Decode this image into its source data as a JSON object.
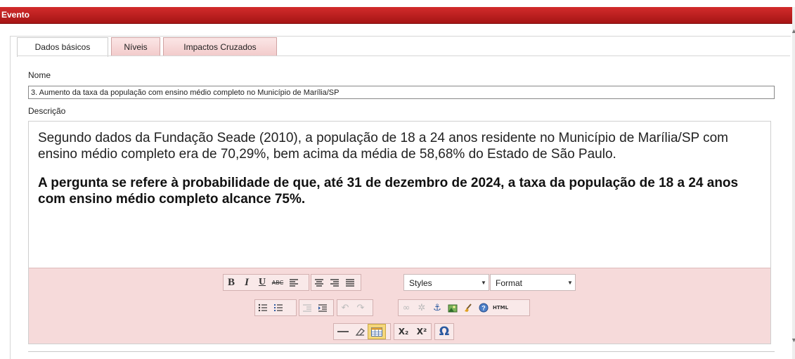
{
  "window": {
    "title": "Evento"
  },
  "tabs": [
    {
      "label": "Dados básicos",
      "active": true
    },
    {
      "label": "Níveis",
      "active": false
    },
    {
      "label": "Impactos Cruzados",
      "active": false
    }
  ],
  "form": {
    "name_label": "Nome",
    "name_value": "3. Aumento da taxa da população com ensino médio completo no Município de Marília/SP",
    "description_label": "Descrição"
  },
  "editor": {
    "paragraph1": "Segundo dados da Fundação Seade (2010), a população de 18 a 24 anos residente no Município de Marília/SP com ensino médio completo era de 70,29%, bem acima da média de 58,68% do Estado de São Paulo.",
    "paragraph2": "A pergunta se refere à probabilidade de que, até 31 de dezembro de 2024, a taxa da população de 18 a 24 anos com ensino médio completo alcance 75%."
  },
  "toolbar": {
    "bold": "B",
    "italic": "I",
    "underline": "U",
    "strike": "ABC",
    "styles_value": "Styles",
    "format_value": "Format",
    "html_label": "HTML",
    "subscript": "X₂",
    "superscript": "X²",
    "special_char": "Ω",
    "icons": [
      "bold-icon",
      "italic-icon",
      "underline-icon",
      "strikethrough-icon",
      "align-left-icon",
      "align-center-icon",
      "align-right-icon",
      "align-justify-icon",
      "bullet-list-icon",
      "numbered-list-icon",
      "outdent-icon",
      "indent-icon",
      "undo-icon",
      "redo-icon",
      "link-icon",
      "unlink-icon",
      "anchor-icon",
      "image-icon",
      "cleanup-icon",
      "help-icon",
      "html-source-icon",
      "horizontal-rule-icon",
      "remove-format-icon",
      "table-icon",
      "subscript-icon",
      "superscript-icon",
      "special-char-icon"
    ]
  }
}
